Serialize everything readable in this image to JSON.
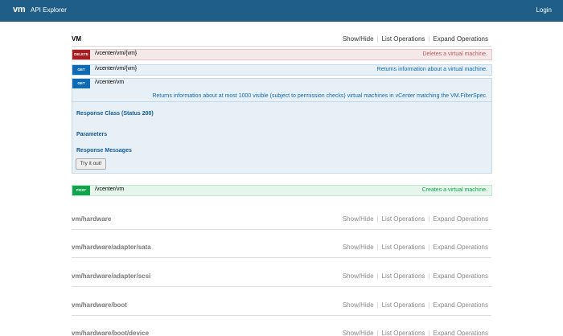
{
  "header": {
    "logo": "vm",
    "title": "API Explorer",
    "login": "Login"
  },
  "colors": {
    "header_bg": "#1f5e87",
    "delete": "#a41e22",
    "get": "#0f6ab4",
    "post": "#10a54a"
  },
  "main_section": {
    "title": "VM",
    "show_hide": "Show/Hide",
    "list_operations": "List Operations",
    "expand_operations": "Expand Operations",
    "operations": [
      {
        "method": "DELETE",
        "path": "/vcenter/vm/{vm}",
        "summary": "Deletes a virtual machine."
      },
      {
        "method": "GET",
        "path": "/vcenter/vm/{vm}",
        "summary": "Returns information about a virtual machine."
      },
      {
        "method": "GET",
        "path": "/vcenter/vm",
        "summary": "Returns information about at most 1000 visible (subject to permission checks) virtual machines in vCenter matching the VM.FilterSpec.",
        "response_class": "Response Class (Status 200)",
        "parameters": "Parameters",
        "response_messages": "Response Messages",
        "try_button": "Try it out!"
      },
      {
        "method": "POST",
        "path": "/vcenter/vm",
        "summary": "Creates a virtual machine."
      }
    ]
  },
  "other_sections": [
    {
      "title": "vm/hardware",
      "show_hide": "Show/Hide",
      "list_operations": "List Operations",
      "expand_operations": "Expand Operations"
    },
    {
      "title": "vm/hardware/adapter/sata",
      "show_hide": "Show/Hide",
      "list_operations": "List Operations",
      "expand_operations": "Expand Operations"
    },
    {
      "title": "vm/hardware/adapter/scsi",
      "show_hide": "Show/Hide",
      "list_operations": "List Operations",
      "expand_operations": "Expand Operations"
    },
    {
      "title": "vm/hardware/boot",
      "show_hide": "Show/Hide",
      "list_operations": "List Operations",
      "expand_operations": "Expand Operations"
    },
    {
      "title": "vm/hardware/boot/device",
      "show_hide": "Show/Hide",
      "list_operations": "List Operations",
      "expand_operations": "Expand Operations"
    }
  ]
}
